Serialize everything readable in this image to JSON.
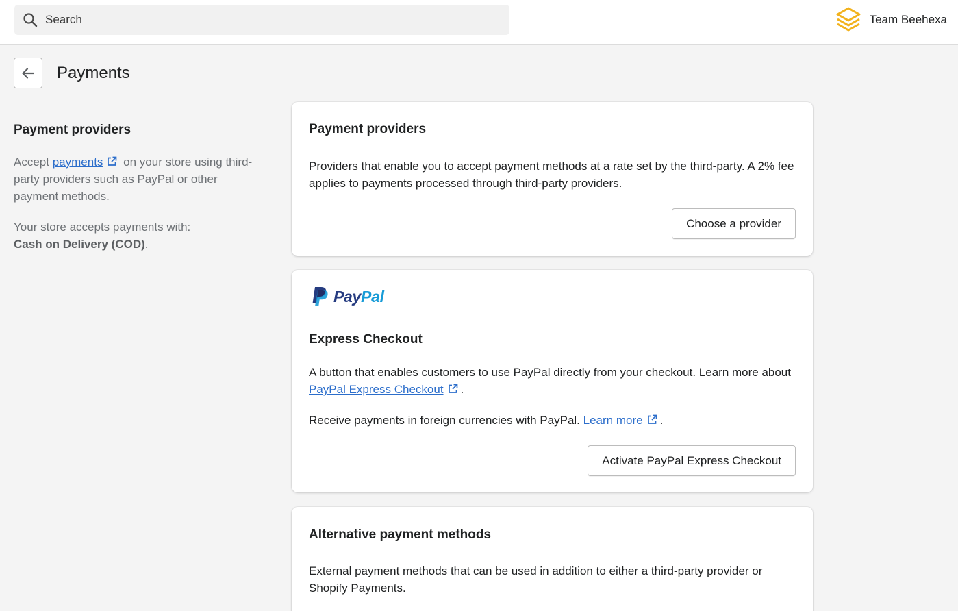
{
  "topbar": {
    "search_placeholder": "Search",
    "store_name": "Team Beehexa",
    "logo_icon": "stacked-hexagon-logo",
    "logo_color": "#f2b21d"
  },
  "page": {
    "title": "Payments",
    "back_icon": "arrow-left-icon"
  },
  "left": {
    "heading": "Payment providers",
    "text_before_link": "Accept",
    "link_label": "payments",
    "text_after_link": "on your store using third-party providers such as PayPal or other payment methods.",
    "accepts_label": "Your store accepts payments with:",
    "accepts_method": "Cash on Delivery (COD)",
    "accepts_suffix": "."
  },
  "providers_card": {
    "title": "Payment providers",
    "description": "Providers that enable you to accept payment methods at a rate set by the third-party. A 2% fee applies to payments processed through third-party providers.",
    "button": "Choose a provider"
  },
  "paypal_card": {
    "logo_pay": "Pay",
    "logo_pal": "Pal",
    "brand_colors": {
      "pay": "#253b80",
      "pal": "#179bd7"
    },
    "title": "Express Checkout",
    "desc_before_link": "A button that enables customers to use PayPal directly from your checkout. Learn more about",
    "desc_link": "PayPal Express Checkout",
    "desc_after_link": ".",
    "currency_text": "Receive payments in foreign currencies with PayPal.",
    "currency_link": "Learn more",
    "currency_after": ".",
    "button": "Activate PayPal Express Checkout"
  },
  "alt_card": {
    "title": "Alternative payment methods",
    "description": "External payment methods that can be used in addition to either a third-party provider or Shopify Payments."
  },
  "colors": {
    "link": "#2c6ecb",
    "page_bg": "#f4f4f4",
    "muted_text": "#6d7175"
  }
}
